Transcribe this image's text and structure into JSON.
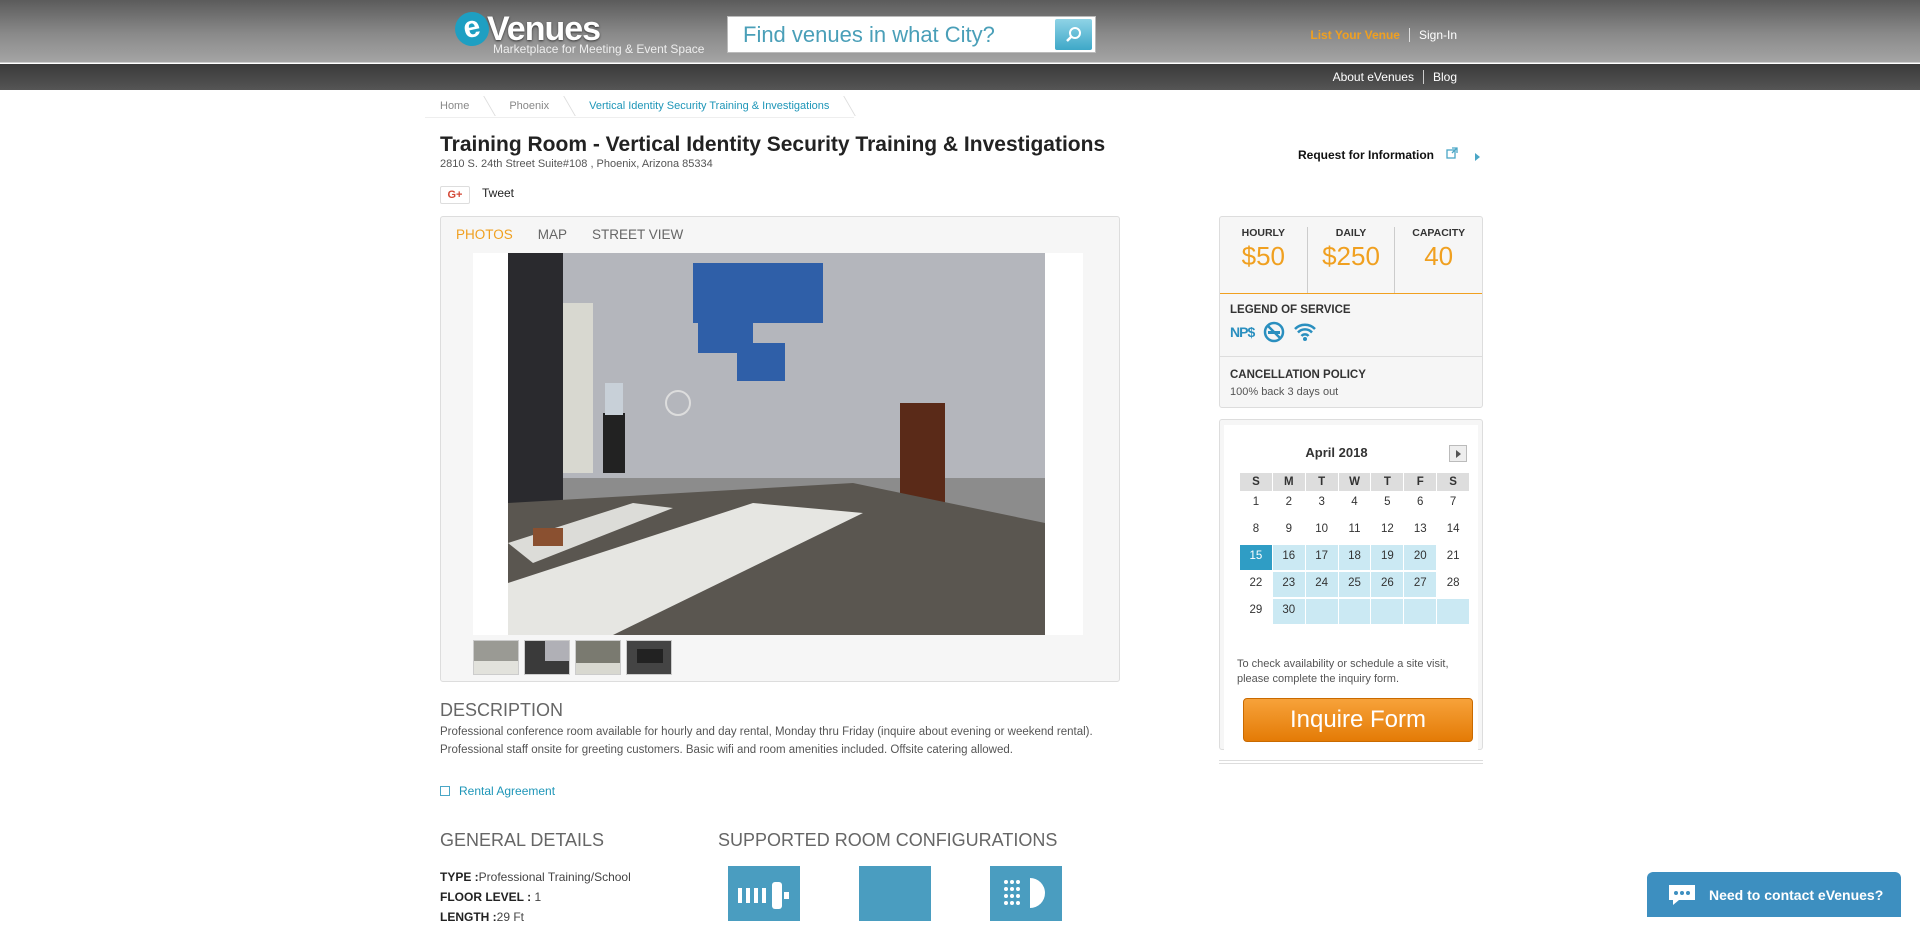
{
  "header": {
    "logo_text": "eVenues",
    "logo_tagline": "Marketplace for Meeting & Event Space",
    "search_placeholder": "Find venues in what City?",
    "list_venue": "List Your Venue",
    "sign_in": "Sign-In",
    "about": "About eVenues",
    "blog": "Blog"
  },
  "breadcrumb": [
    "Home",
    "Phoenix",
    "Vertical Identity Security Training & Investigations"
  ],
  "venue": {
    "title": "Training Room - Vertical Identity Security Training & Investigations",
    "address": "2810 S. 24th Street Suite#108 , Phoenix, Arizona 85334",
    "gplus": "G+",
    "tweet": "Tweet",
    "request_info": "Request for Information"
  },
  "photo_tabs": [
    "PHOTOS",
    "MAP",
    "STREET VIEW"
  ],
  "pricing": {
    "hourly_label": "HOURLY",
    "hourly": "$50",
    "daily_label": "DAILY",
    "daily": "$250",
    "capacity_label": "CAPACITY",
    "capacity": "40",
    "legend_label": "LEGEND OF SERVICE",
    "legend_icons": [
      "nps-icon",
      "no-smoking-icon",
      "wifi-icon"
    ],
    "nps_text": "NP$",
    "cancel_label": "CANCELLATION POLICY",
    "cancel_text": "100% back 3 days out"
  },
  "calendar": {
    "month": "April 2018",
    "days": [
      "S",
      "M",
      "T",
      "W",
      "T",
      "F",
      "S"
    ],
    "weeks": [
      [
        "1",
        "2",
        "3",
        "4",
        "5",
        "6",
        "7"
      ],
      [
        "8",
        "9",
        "10",
        "11",
        "12",
        "13",
        "14"
      ],
      [
        "15",
        "16",
        "17",
        "18",
        "19",
        "20",
        "21"
      ],
      [
        "22",
        "23",
        "24",
        "25",
        "26",
        "27",
        "28"
      ],
      [
        "29",
        "30",
        "",
        "",
        "",
        "",
        ""
      ]
    ],
    "today": "15",
    "available": [
      "15",
      "16",
      "17",
      "18",
      "19",
      "20",
      "23",
      "24",
      "25",
      "26",
      "27",
      "30"
    ],
    "note": "To check availability or schedule a site visit, please complete the inquiry form.",
    "inquire_button": "Inquire Form"
  },
  "description": {
    "heading": "DESCRIPTION",
    "text": "Professional conference room available for hourly and day rental, Monday thru Friday (inquire about evening or weekend rental). Professional staff onsite for greeting customers. Basic wifi and room amenities included. Offsite catering allowed.",
    "rental_link": "Rental Agreement"
  },
  "general_details": {
    "heading": "GENERAL DETAILS",
    "type_label": "TYPE :",
    "type": "Professional Training/School",
    "floor_label": "FLOOR LEVEL :",
    "floor": "1",
    "length_label": "LENGTH :",
    "length": "29 Ft"
  },
  "configs": {
    "heading": "SUPPORTED ROOM CONFIGURATIONS"
  },
  "chat": {
    "label": "Need to contact eVenues?"
  },
  "colors": {
    "accent": "#f0a020",
    "link": "#1e96b8",
    "calendar_available": "#cbe9f3",
    "calendar_today": "#2f9dc5"
  }
}
